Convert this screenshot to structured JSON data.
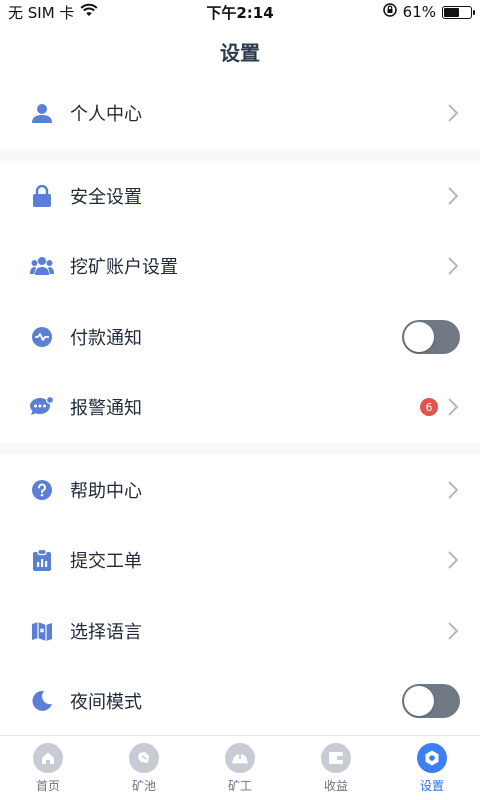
{
  "status_bar": {
    "carrier": "无 SIM 卡",
    "time": "下午2:14",
    "battery_percent": "61%",
    "battery_level": 0.61,
    "wifi_icon": "wifi-icon",
    "lock_icon": "orientation-lock-icon"
  },
  "header": {
    "title": "设置"
  },
  "groups": [
    {
      "items": [
        {
          "label": "个人中心",
          "icon": "user-icon"
        }
      ]
    },
    {
      "items": [
        {
          "label": "安全设置",
          "icon": "lock-icon"
        },
        {
          "label": "挖矿账户设置",
          "icon": "users-icon"
        },
        {
          "label": "付款通知",
          "icon": "payment-wave-icon",
          "toggle": false
        },
        {
          "label": "报警通知",
          "icon": "chat-alert-icon",
          "badge": "6"
        }
      ]
    },
    {
      "items": [
        {
          "label": "帮助中心",
          "icon": "help-icon"
        },
        {
          "label": "提交工单",
          "icon": "clipboard-icon"
        },
        {
          "label": "选择语言",
          "icon": "map-language-icon"
        },
        {
          "label": "夜间模式",
          "icon": "moon-icon",
          "toggle": false
        }
      ]
    }
  ],
  "tabs": [
    {
      "label": "首页",
      "icon": "home-icon",
      "active": false
    },
    {
      "label": "矿池",
      "icon": "pool-icon",
      "active": false
    },
    {
      "label": "矿工",
      "icon": "helmet-icon",
      "active": false
    },
    {
      "label": "收益",
      "icon": "wallet-icon",
      "active": false
    },
    {
      "label": "设置",
      "icon": "settings-icon",
      "active": true
    }
  ],
  "colors": {
    "accent": "#3c7ff0",
    "icon_blue": "#5b7fd6",
    "badge_red": "#e5534b",
    "toggle_off": "#6f7883"
  }
}
